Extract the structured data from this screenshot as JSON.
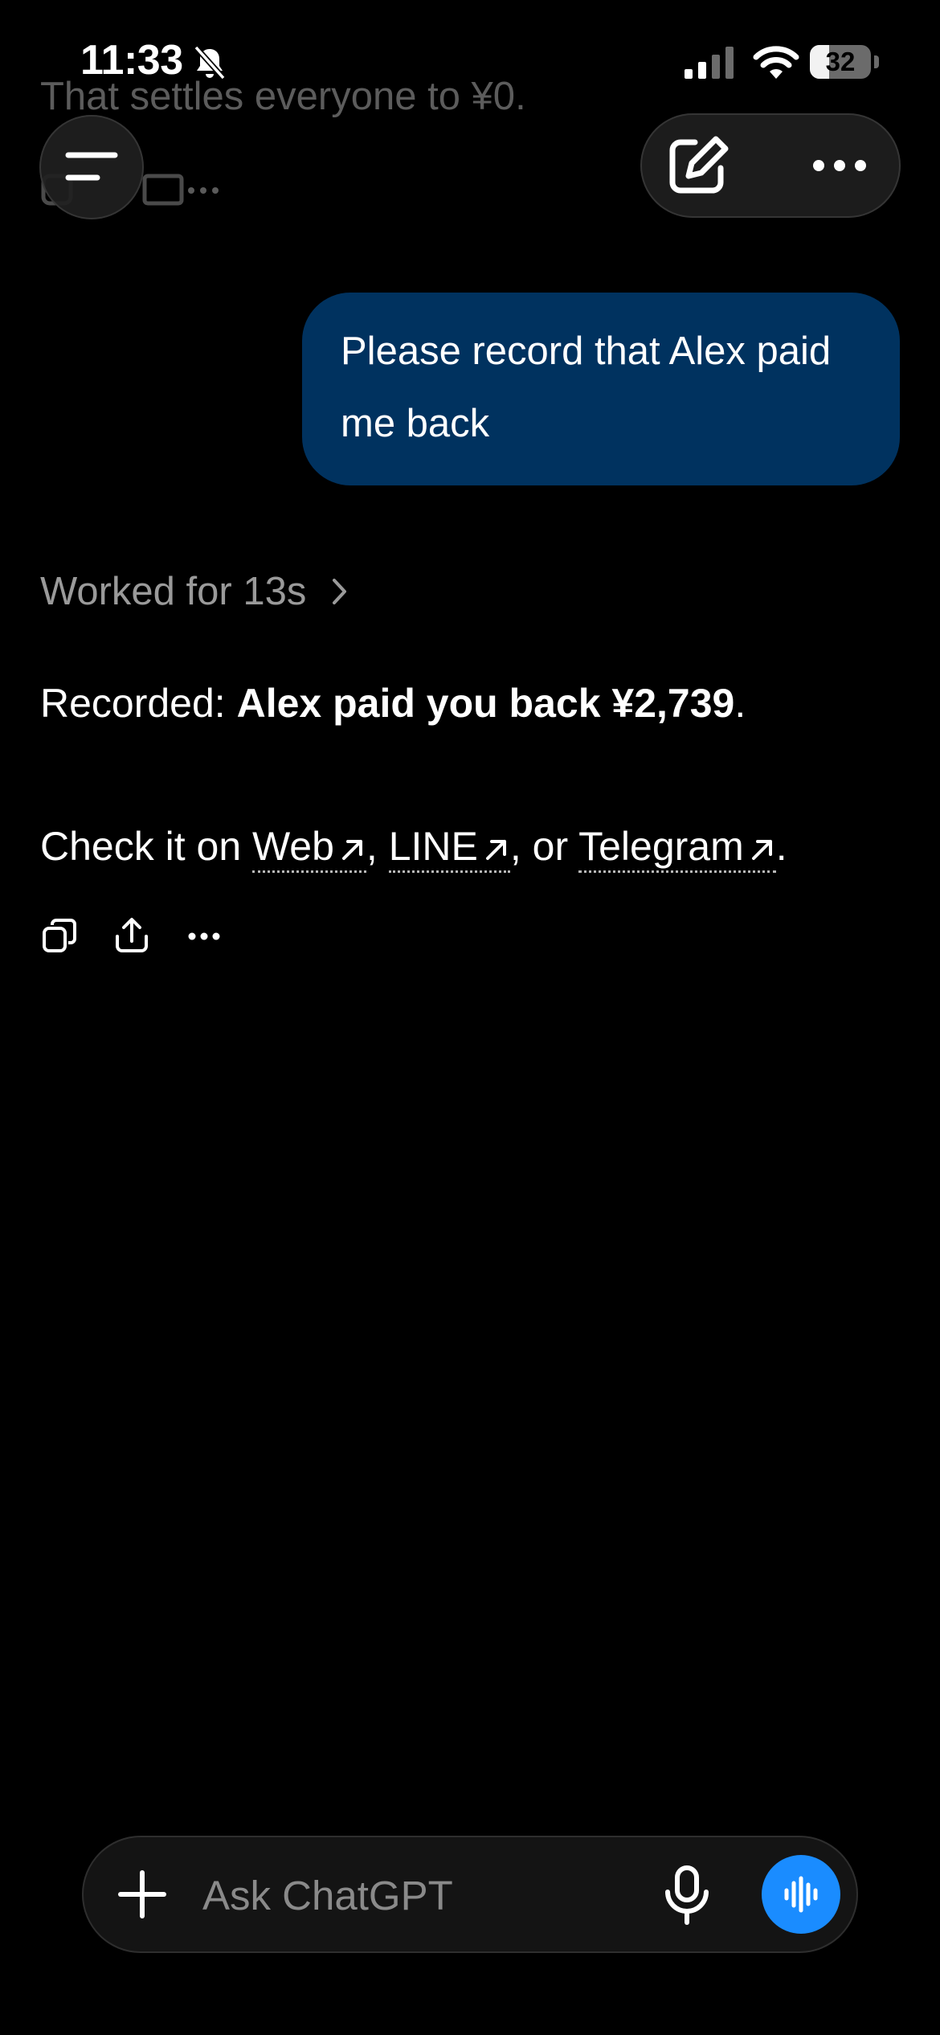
{
  "previous_message": {
    "text": "That settles everyone to ¥0."
  },
  "status_bar": {
    "time": "11:33",
    "battery_level": "32",
    "silent_icon": "bell-slash-icon",
    "signal_icon": "cellular-signal-icon",
    "wifi_icon": "wifi-icon"
  },
  "header": {
    "menu_icon": "menu-icon",
    "compose_icon": "compose-icon",
    "more_icon": "ellipsis-icon"
  },
  "user_message": {
    "line1": "Please record that Alex paid",
    "line2": "me back"
  },
  "assistant": {
    "worked_label": "Worked for 13s",
    "recorded_prefix": "Recorded: ",
    "recorded_bold": "Alex paid you back ¥2,739",
    "recorded_suffix": ".",
    "check_prefix": "Check it on ",
    "links": [
      "Web",
      "LINE",
      "Telegram"
    ],
    "sep1": ", ",
    "sep2": ", or ",
    "check_suffix": ".",
    "action_icons": [
      "copy-icon",
      "share-icon",
      "ellipsis-icon"
    ]
  },
  "composer": {
    "placeholder": "Ask ChatGPT",
    "plus_icon": "plus-icon",
    "mic_icon": "microphone-icon",
    "voice_icon": "voice-mode-icon"
  },
  "colors": {
    "background": "#000000",
    "user_bubble": "#00325f",
    "voice_button": "#1a8cff",
    "muted_text": "#9a9a9a"
  }
}
